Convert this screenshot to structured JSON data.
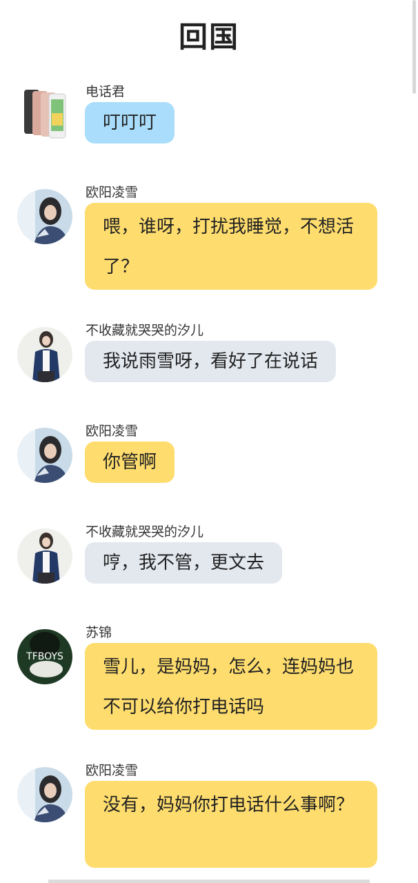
{
  "header": {
    "title": "回国"
  },
  "messages": [
    {
      "sender": "电话君",
      "text": "叮叮叮",
      "avatar": "phone-avatar",
      "color": "#a9ddfb"
    },
    {
      "sender": "欧阳凌雪",
      "text": "喂，谁呀，打扰我睡觉，不想活了？",
      "avatar": "girl-avatar",
      "color": "#fedd6e"
    },
    {
      "sender": "不收藏就哭哭的汐儿",
      "text": "我说雨雪呀，看好了在说话",
      "avatar": "girl-jacket-avatar",
      "color": "#e3e8ef"
    },
    {
      "sender": "欧阳凌雪",
      "text": "你管啊",
      "avatar": "girl-avatar",
      "color": "#fedd6e"
    },
    {
      "sender": "不收藏就哭哭的汐儿",
      "text": "哼，我不管，更文去",
      "avatar": "girl-jacket-avatar",
      "color": "#e3e8ef"
    },
    {
      "sender": "苏锦",
      "text": "雪儿，是妈妈，怎么，连妈妈也不可以给你打电话吗",
      "avatar": "tfboys-avatar",
      "avatar_text": "TFBOYS",
      "color": "#fedd6e"
    },
    {
      "sender": "欧阳凌雪",
      "text": "没有，妈妈你打电话什么事啊？",
      "avatar": "girl-avatar",
      "color": "#fedd6e"
    }
  ]
}
